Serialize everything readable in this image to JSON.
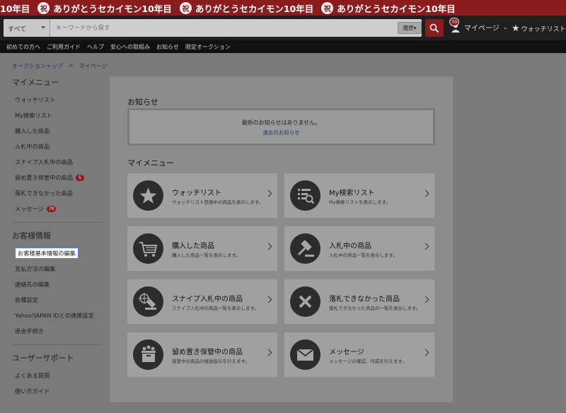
{
  "banner": {
    "text": "ありがとうセカイモン10年目",
    "lead": "10年目",
    "seal": "祝",
    "repeat": 3
  },
  "header": {
    "category": "すべて",
    "search_placeholder": "キーワードから探す",
    "history_label": "履歴▾",
    "mypage_label": "マイページ",
    "mypage_badge": "70",
    "watchlist_label": "ウォッチリスト"
  },
  "subnav": [
    "初めての方へ",
    "ご利用ガイド",
    "ヘルプ",
    "安心への取組み",
    "お知らせ",
    "限定オークション"
  ],
  "breadcrumb": {
    "home": "オークショントップ",
    "sep": ">",
    "current": "マイページ"
  },
  "sidebar": {
    "menu_title": "マイメニュー",
    "menu_items": [
      {
        "label": "ウォッチリスト",
        "count": ""
      },
      {
        "label": "My検索リスト",
        "count": ""
      },
      {
        "label": "購入した商品",
        "count": ""
      },
      {
        "label": "入札中の商品",
        "count": ""
      },
      {
        "label": "スナイプ入札中の商品",
        "count": ""
      },
      {
        "label": "留め置き保管中の商品",
        "count": "5"
      },
      {
        "label": "落札できなかった商品",
        "count": ""
      },
      {
        "label": "メッセージ",
        "count": "70"
      }
    ],
    "customer_title": "お客様情報",
    "customer_items": [
      "お客様基本情報の編集",
      "支払方法の編集",
      "連絡先の編集",
      "各種設定",
      "Yahoo!JAPAN IDとの連携設定",
      "退会手続き"
    ],
    "support_title": "ユーザーサポート",
    "support_items": [
      "よくある質問",
      "使い方ガイド"
    ]
  },
  "main": {
    "notice_title": "お知らせ",
    "notice_empty": "最新のお知らせはありません。",
    "notice_link": "過去のお知らせ",
    "menu_title": "マイメニュー",
    "cards": [
      {
        "title": "ウォッチリスト",
        "desc": "ウォッチリスト登録中の商品を表示します。",
        "icon": "star-icon"
      },
      {
        "title": "My検索リスト",
        "desc": "My検索リストを表示します。",
        "icon": "search-list-icon"
      },
      {
        "title": "購入した商品",
        "desc": "購入した商品一覧を表示します。",
        "icon": "cart-icon"
      },
      {
        "title": "入札中の商品",
        "desc": "入札中の商品一覧を表示します。",
        "icon": "gavel-icon"
      },
      {
        "title": "スナイプ入札中の商品",
        "desc": "スナイプ入札中の商品一覧を表示します。",
        "icon": "snipe-icon"
      },
      {
        "title": "落札できなかった商品",
        "desc": "落札できなかった商品の一覧を表示します。",
        "icon": "x-icon"
      },
      {
        "title": "留め置き保管中の商品",
        "desc": "保管中の商品の発送指示を行えます。",
        "icon": "box-icon"
      },
      {
        "title": "メッセージ",
        "desc": "メッセージの確認、作成を行えます。",
        "icon": "mail-icon"
      }
    ]
  }
}
